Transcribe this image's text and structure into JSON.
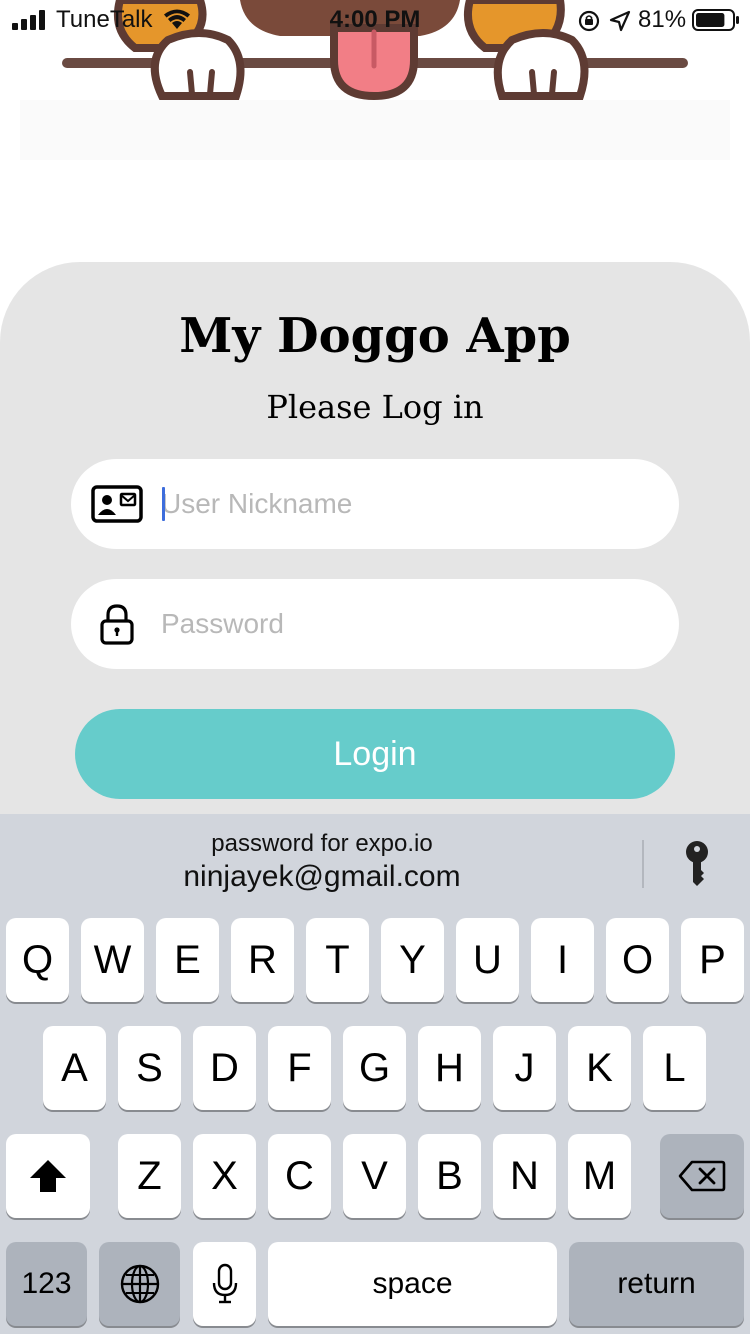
{
  "status_bar": {
    "carrier": "TuneTalk",
    "time": "4:00 PM",
    "battery_percent": "81%",
    "battery_level": 0.81,
    "icons": [
      "signal-icon",
      "wifi-icon",
      "orientation-lock-icon",
      "location-icon",
      "battery-icon"
    ]
  },
  "login": {
    "title": "My Doggo App",
    "subtitle": "Please Log in",
    "nickname": {
      "placeholder": "User Nickname",
      "value": "",
      "icon": "id-card-icon"
    },
    "password": {
      "placeholder": "Password",
      "value": "",
      "icon": "lock-icon"
    },
    "button_label": "Login"
  },
  "autofill": {
    "caption": "password for expo.io",
    "account": "ninjayek@gmail.com",
    "icon": "key-icon"
  },
  "keyboard": {
    "row1": [
      "Q",
      "W",
      "E",
      "R",
      "T",
      "Y",
      "U",
      "I",
      "O",
      "P"
    ],
    "row2": [
      "A",
      "S",
      "D",
      "F",
      "G",
      "H",
      "J",
      "K",
      "L"
    ],
    "row3": [
      "Z",
      "X",
      "C",
      "V",
      "B",
      "N",
      "M"
    ],
    "numbers_label": "123",
    "space_label": "space",
    "return_label": "return",
    "special_icons": [
      "shift-icon",
      "backspace-icon",
      "globe-icon",
      "microphone-icon"
    ]
  },
  "colors": {
    "card_background": "#e5e5e5",
    "login_button": "#66cccb",
    "caret": "#3d6ddc",
    "keyboard_background": "#d1d5dc"
  }
}
